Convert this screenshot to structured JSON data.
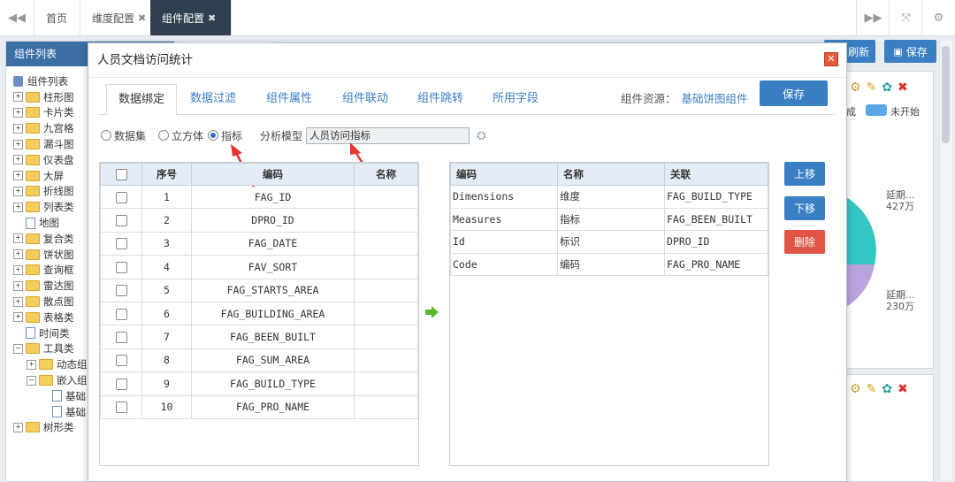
{
  "topbar": {
    "tabs": [
      {
        "label": "首页",
        "closable": false
      },
      {
        "label": "维度配置",
        "closable": true
      },
      {
        "label": "组件配置",
        "closable": true,
        "active": true
      }
    ],
    "close_glyph": "✖"
  },
  "sidebar": {
    "title": "组件列表",
    "items": [
      {
        "label": "组件列表",
        "type": "root"
      },
      {
        "label": "柱形图",
        "type": "folder"
      },
      {
        "label": "卡片类",
        "type": "folder"
      },
      {
        "label": "九宫格",
        "type": "folder"
      },
      {
        "label": "漏斗图",
        "type": "folder"
      },
      {
        "label": "仪表盘",
        "type": "folder"
      },
      {
        "label": "大屏",
        "type": "folder"
      },
      {
        "label": "折线图",
        "type": "folder"
      },
      {
        "label": "列表类",
        "type": "folder"
      },
      {
        "label": "地图",
        "type": "file"
      },
      {
        "label": "复合类",
        "type": "folder"
      },
      {
        "label": "饼状图",
        "type": "folder"
      },
      {
        "label": "查询框",
        "type": "folder"
      },
      {
        "label": "雷达图",
        "type": "folder"
      },
      {
        "label": "散点图",
        "type": "folder"
      },
      {
        "label": "表格类",
        "type": "folder"
      },
      {
        "label": "时间类",
        "type": "file"
      },
      {
        "label": "工具类",
        "type": "folder-open"
      },
      {
        "label": "动态组",
        "type": "folder",
        "indent": 1
      },
      {
        "label": "嵌入组",
        "type": "folder-open",
        "indent": 1
      },
      {
        "label": "基础",
        "type": "file",
        "indent": 2
      },
      {
        "label": "基础",
        "type": "file",
        "indent": 2
      },
      {
        "label": "树形类",
        "type": "folder"
      }
    ]
  },
  "background": {
    "refresh_label": "刷新",
    "save_label": "保存",
    "legend_partial": "成",
    "legend_label": "未开始",
    "legend_color": "#5aa9e6",
    "pie_label_1": "延期...",
    "pie_value_1": "427万",
    "pie_label_2": "延期...",
    "pie_value_2": "230万"
  },
  "dialog": {
    "title": "人员文档访问统计",
    "tabs": [
      "数据绑定",
      "数据过滤",
      "组件属性",
      "组件联动",
      "组件跳转",
      "所用字段"
    ],
    "active_tab": 0,
    "resource_label": "组件资源：",
    "resource_value": "基础饼图组件",
    "save_label": "保存",
    "source_options": [
      "数据集",
      "立方体",
      "指标"
    ],
    "selected_source": "指标",
    "model_label": "分析模型",
    "model_value": "人员访问指标",
    "left_table": {
      "headers": [
        "序号",
        "编码",
        "名称"
      ],
      "rows": [
        {
          "no": "1",
          "code": "FAG_ID",
          "name": ""
        },
        {
          "no": "2",
          "code": "DPRO_ID",
          "name": ""
        },
        {
          "no": "3",
          "code": "FAG_DATE",
          "name": ""
        },
        {
          "no": "4",
          "code": "FAV_SORT",
          "name": ""
        },
        {
          "no": "5",
          "code": "FAG_STARTS_AREA",
          "name": ""
        },
        {
          "no": "6",
          "code": "FAG_BUILDING_AREA",
          "name": ""
        },
        {
          "no": "7",
          "code": "FAG_BEEN_BUILT",
          "name": ""
        },
        {
          "no": "8",
          "code": "FAG_SUM_AREA",
          "name": ""
        },
        {
          "no": "9",
          "code": "FAG_BUILD_TYPE",
          "name": ""
        },
        {
          "no": "10",
          "code": "FAG_PRO_NAME",
          "name": ""
        }
      ]
    },
    "right_table": {
      "headers": [
        "编码",
        "名称",
        "关联"
      ],
      "rows": [
        {
          "code": "Dimensions",
          "name": "维度",
          "link": "FAG_BUILD_TYPE"
        },
        {
          "code": "Measures",
          "name": "指标",
          "link": "FAG_BEEN_BUILT"
        },
        {
          "code": "Id",
          "name": "标识",
          "link": "DPRO_ID"
        },
        {
          "code": "Code",
          "name": "编码",
          "link": "FAG_PRO_NAME"
        }
      ]
    },
    "move_up_label": "上移",
    "move_down_label": "下移",
    "delete_label": "删除"
  },
  "colors": {
    "primary": "#3a7fc4",
    "danger": "#e05545",
    "header_dark": "#2f4050",
    "arrow_red": "#e8322d",
    "arrow_green": "#5cb531"
  }
}
